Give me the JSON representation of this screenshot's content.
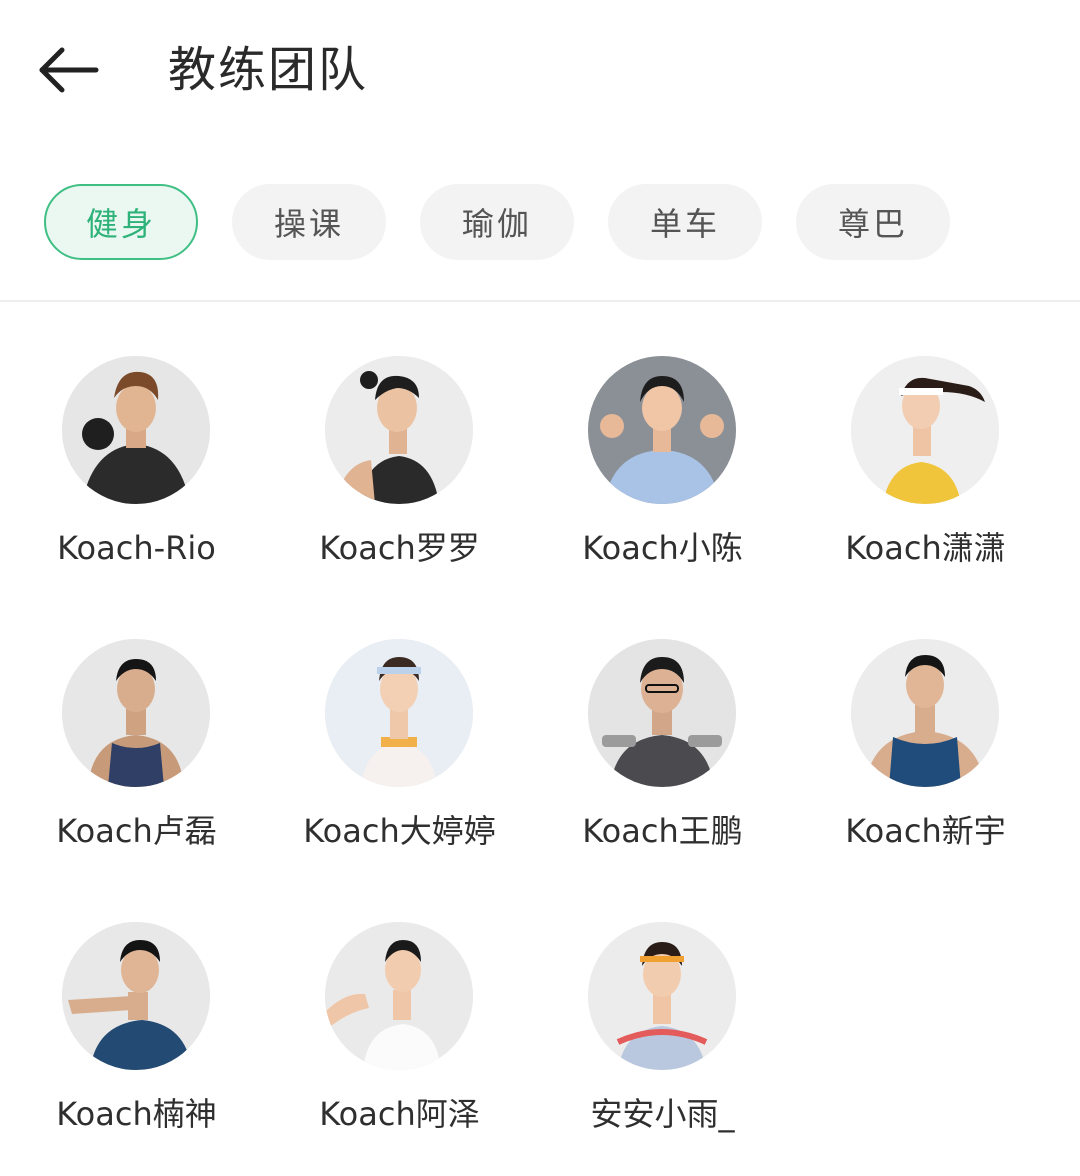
{
  "header": {
    "back_icon": "arrow-left-icon",
    "title": "教练团队"
  },
  "tabs": [
    {
      "label": "健身",
      "active": true
    },
    {
      "label": "操课",
      "active": false
    },
    {
      "label": "瑜伽",
      "active": false
    },
    {
      "label": "单车",
      "active": false
    },
    {
      "label": "尊巴",
      "active": false
    }
  ],
  "colors": {
    "accent": "#3fbf84",
    "accent_bg": "#eaf8f1",
    "tab_bg": "#f3f3f3"
  },
  "coaches": [
    {
      "name": "Koach-Rio"
    },
    {
      "name": "Koach罗罗"
    },
    {
      "name": "Koach小陈"
    },
    {
      "name": "Koach潇潇"
    },
    {
      "name": "Koach卢磊"
    },
    {
      "name": "Koach大婷婷"
    },
    {
      "name": "Koach王鹏"
    },
    {
      "name": "Koach新宇"
    },
    {
      "name": "Koach楠神"
    },
    {
      "name": "Koach阿泽"
    },
    {
      "name": "安安小雨_"
    }
  ]
}
